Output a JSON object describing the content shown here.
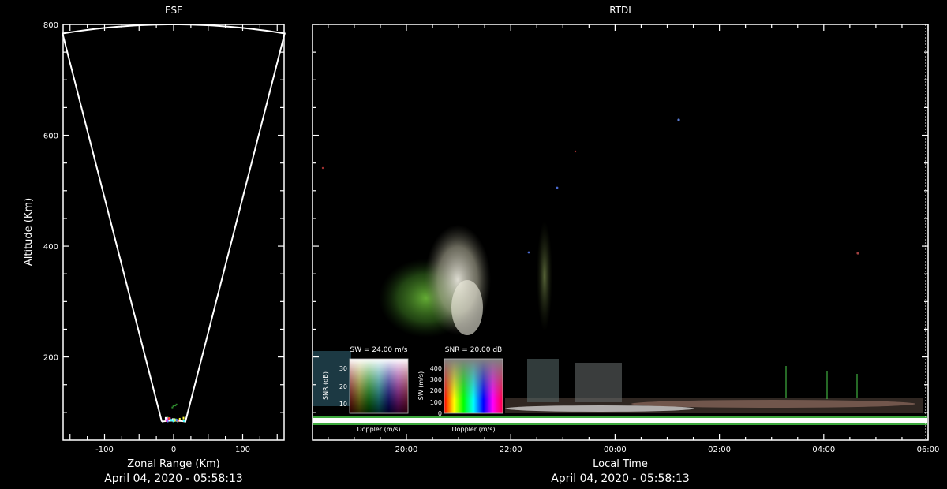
{
  "chart_data": [
    {
      "type": "scatter",
      "panel": "ESF",
      "title": "ESF",
      "xlabel": "Zonal Range (Km)",
      "ylabel": "Altitude (Km)",
      "timestamp": "April 04, 2020 - 05:58:13",
      "xlim": [
        -160,
        160
      ],
      "ylim": [
        50,
        800
      ],
      "x_ticks": [
        -100,
        0,
        100
      ],
      "y_ticks": [
        200,
        400,
        600,
        800
      ],
      "fan": {
        "range_max_km": 800,
        "half_angle_deg": 11.6,
        "range_min_km": 85
      }
    },
    {
      "type": "heatmap",
      "panel": "RTDI",
      "title": "RTDI",
      "xlabel": "Local Time",
      "timestamp": "April 04, 2020 - 05:58:13",
      "x_ticks": [
        "20:00",
        "22:00",
        "00:00",
        "02:00",
        "04:00",
        "06:00"
      ],
      "xlim_hours": [
        18.2,
        30.0
      ],
      "ylim": [
        50,
        800
      ],
      "plumes": [
        {
          "start": "20:40",
          "end": "21:40",
          "alt_low": 200,
          "alt_high": 400,
          "color": "#d8d6cc"
        },
        {
          "start": "19:50",
          "end": "20:50",
          "alt_low": 200,
          "alt_high": 350,
          "color": "#4f9a2d"
        },
        {
          "start": "22:30",
          "end": "22:50",
          "alt_low": 200,
          "alt_high": 420,
          "color": "#6b8d3a"
        }
      ]
    }
  ],
  "legends": {
    "sw_box": {
      "title": "SW = 24.00 m/s",
      "ylabel": "SNR (dB)",
      "xlabel": "Doppler (m/s)",
      "ticks": [
        "30",
        "20",
        "10"
      ]
    },
    "snr_box": {
      "title": "SNR = 20.00 dB",
      "ylabel": "SW (m/s)",
      "xlabel": "Doppler (m/s)",
      "ticks": [
        "400",
        "300",
        "200",
        "100",
        "0"
      ]
    }
  },
  "colors": {
    "background": "#000000",
    "foreground": "#ffffff",
    "ground_green": "#4cd24c"
  }
}
